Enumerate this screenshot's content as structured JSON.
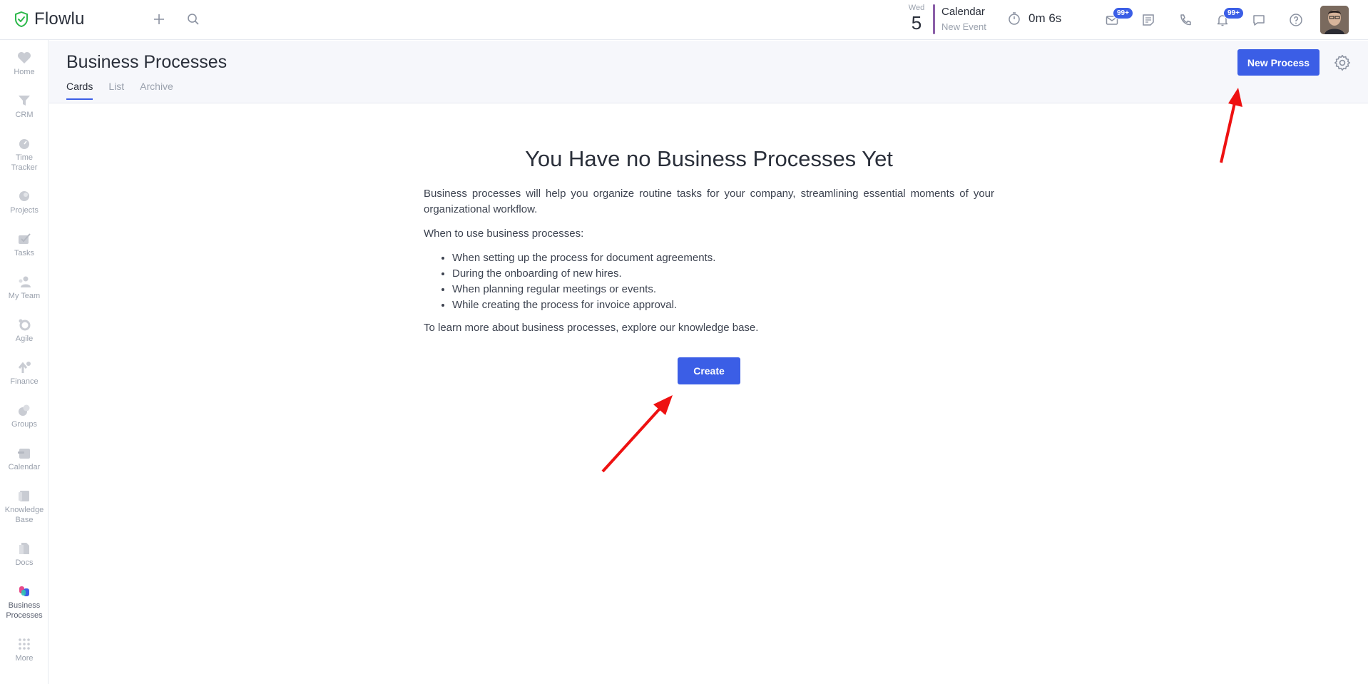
{
  "app": {
    "name": "Flowlu"
  },
  "topbar": {
    "date_day": "Wed",
    "date_num": "5",
    "calendar_title": "Calendar",
    "calendar_sub": "New Event",
    "timer": "0m 6s",
    "mail_badge": "99+",
    "bell_badge": "99+"
  },
  "sidebar": {
    "items": [
      {
        "label": "Home",
        "icon": "heart-icon"
      },
      {
        "label": "CRM",
        "icon": "funnel-icon"
      },
      {
        "label": "Time Tracker",
        "icon": "stopwatch-icon"
      },
      {
        "label": "Projects",
        "icon": "projects-icon"
      },
      {
        "label": "Tasks",
        "icon": "tasks-icon"
      },
      {
        "label": "My Team",
        "icon": "team-icon"
      },
      {
        "label": "Agile",
        "icon": "agile-icon"
      },
      {
        "label": "Finance",
        "icon": "finance-icon"
      },
      {
        "label": "Groups",
        "icon": "groups-icon"
      },
      {
        "label": "Calendar",
        "icon": "calendar-icon"
      },
      {
        "label": "Knowledge Base",
        "icon": "book-icon"
      },
      {
        "label": "Docs",
        "icon": "docs-icon"
      },
      {
        "label": "Business Processes",
        "icon": "business-processes-icon"
      },
      {
        "label": "More",
        "icon": "grid-dots-icon"
      }
    ]
  },
  "header": {
    "title": "Business Processes",
    "tabs": [
      "Cards",
      "List",
      "Archive"
    ],
    "new_button": "New Process"
  },
  "empty": {
    "title": "You Have no Business Processes Yet",
    "intro": "Business processes will help you organize routine tasks for your company, streamlining essential moments of your organizational workflow.",
    "when": "When to use business processes:",
    "bullets": [
      "When setting up the process for document agreements.",
      "During the onboarding of new hires.",
      "When planning regular meetings or events.",
      "While creating the process for invoice approval."
    ],
    "learn_more": "To learn more about business processes, explore our knowledge base.",
    "create_button": "Create"
  },
  "colors": {
    "accent": "#3b5ee6",
    "logo": "#2db84b",
    "arrow": "#ee1111"
  }
}
